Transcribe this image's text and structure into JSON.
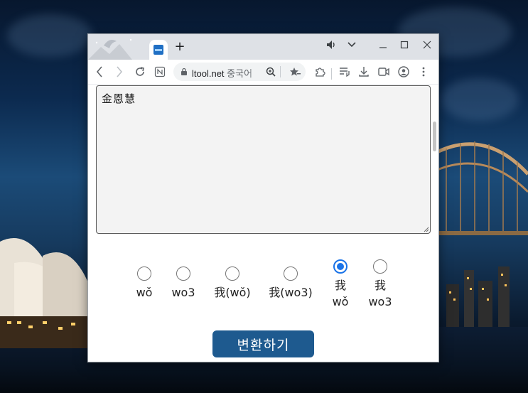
{
  "browser": {
    "new_tab_label": "+",
    "omnibox": {
      "host": "ltool.net",
      "rest": " 중국어"
    }
  },
  "page": {
    "textarea_value": "金恩慧",
    "options": [
      {
        "label_line1": "wǒ",
        "label_line2": "",
        "checked": false
      },
      {
        "label_line1": "wo3",
        "label_line2": "",
        "checked": false
      },
      {
        "label_line1": "我(wǒ)",
        "label_line2": "",
        "checked": false
      },
      {
        "label_line1": "我(wo3)",
        "label_line2": "",
        "checked": false
      },
      {
        "label_line1": "我",
        "label_line2": "wǒ",
        "checked": true
      },
      {
        "label_line1": "我",
        "label_line2": "wo3",
        "checked": false
      }
    ],
    "convert_button": "변환하기"
  },
  "colors": {
    "accent": "#1a73e8",
    "button": "#1e5a8f"
  }
}
